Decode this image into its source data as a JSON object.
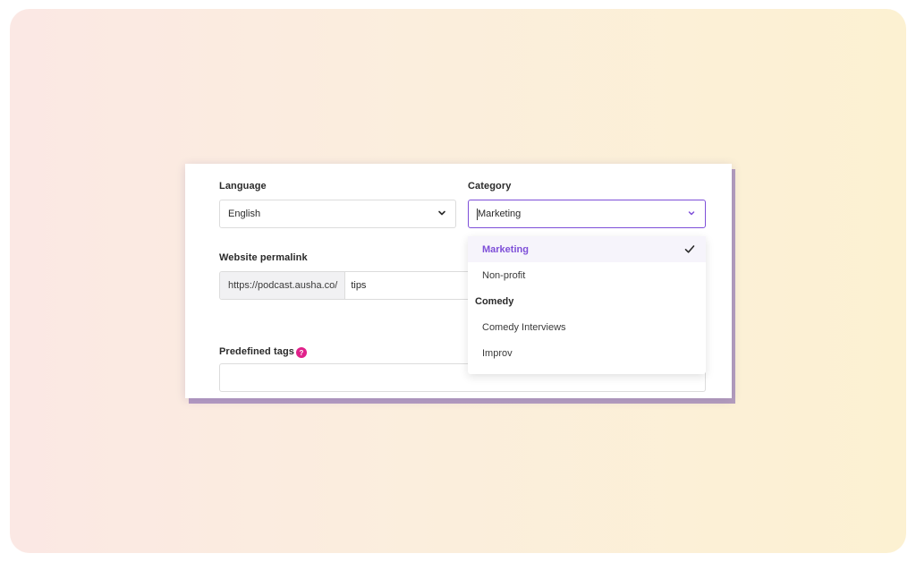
{
  "form": {
    "language": {
      "label": "Language",
      "value": "English"
    },
    "category": {
      "label": "Category",
      "value": "Marketing"
    },
    "website_permalink": {
      "label": "Website permalink",
      "prefix": "https://podcast.ausha.co/",
      "value": "tips"
    },
    "predefined_tags": {
      "label": "Predefined tags",
      "help_icon": "question-mark-icon",
      "help_symbol": "?",
      "value": ""
    }
  },
  "category_dropdown": {
    "items": [
      {
        "type": "option",
        "label": "Marketing",
        "selected": true
      },
      {
        "type": "option",
        "label": "Non-profit",
        "selected": false
      },
      {
        "type": "group",
        "label": "Comedy"
      },
      {
        "type": "option",
        "label": "Comedy Interviews",
        "selected": false
      },
      {
        "type": "option",
        "label": "Improv",
        "selected": false
      }
    ]
  },
  "colors": {
    "accent": "#7e4fd8",
    "help_badge": "#e0218a",
    "card_shadow": "#785aaa"
  }
}
